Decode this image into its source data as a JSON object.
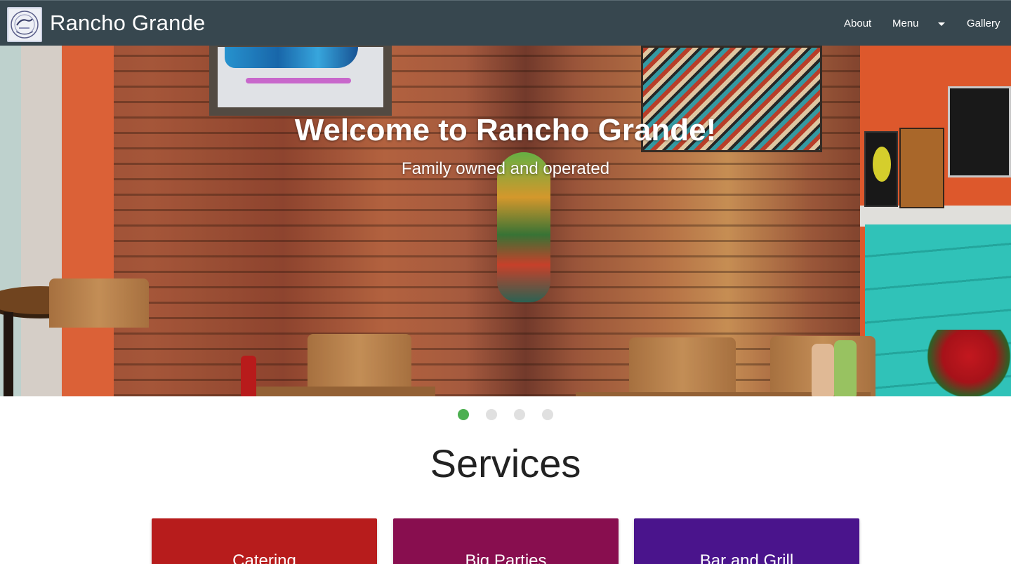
{
  "navbar": {
    "brand": "Rancho Grande",
    "logo_icon": "rancho-grande-logo-icon",
    "links": {
      "about": "About",
      "menu": "Menu",
      "gallery": "Gallery"
    },
    "menu_icon": "caret-down-icon"
  },
  "hero": {
    "title": "Welcome to Rancho Grande!",
    "subtitle": "Family owned and operated"
  },
  "carousel": {
    "slide_count": 4,
    "active_index": 0,
    "active_color": "#4caf50",
    "inactive_color": "#e0e0e0"
  },
  "services": {
    "title": "Services",
    "cards": [
      {
        "label": "Catering",
        "color": "#b71c1c"
      },
      {
        "label": "Big Parties",
        "color": "#880e4f"
      },
      {
        "label": "Bar and Grill",
        "color": "#4a148c"
      }
    ]
  },
  "colors": {
    "navbar_bg": "#37474f",
    "text_light": "#ffffff"
  }
}
